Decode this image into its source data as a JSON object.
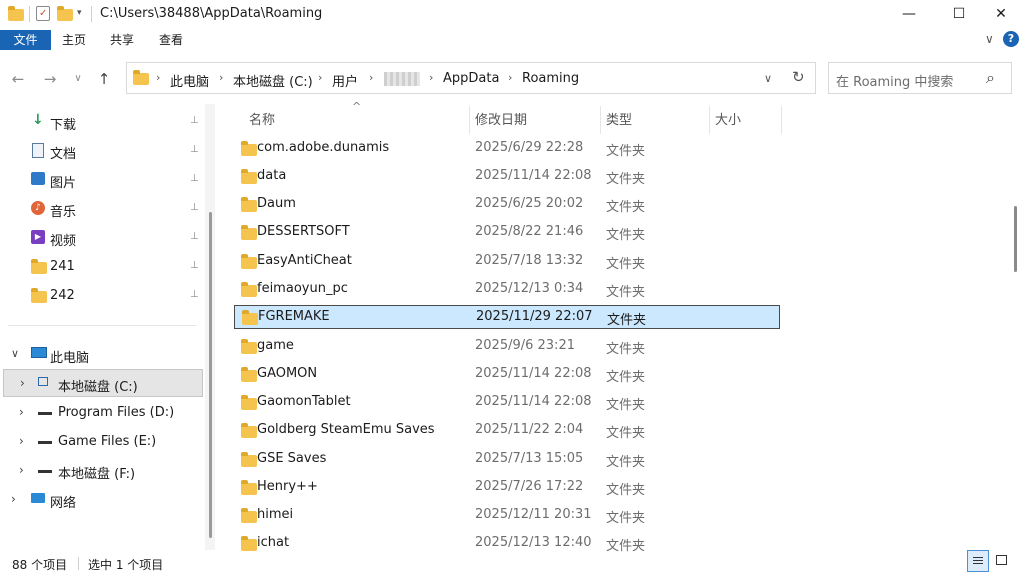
{
  "title": {
    "path": "C:\\Users\\38488\\AppData\\Roaming"
  },
  "window_controls": {
    "minimize": "—",
    "maximize": "☐",
    "close": "✕"
  },
  "ribbon": {
    "tabs": [
      "文件",
      "主页",
      "共享",
      "查看"
    ],
    "expand": "∨",
    "help": "?"
  },
  "nav_buttons": {
    "back": "←",
    "forward": "→",
    "recent": "∨",
    "up": "↑"
  },
  "address": {
    "crumbs": [
      "此电脑",
      "本地磁盘 (C:)",
      "用户",
      "AppData",
      "Roaming"
    ],
    "sep": "›",
    "dropdown": "∨",
    "refresh": "↻"
  },
  "search": {
    "placeholder": "在 Roaming 中搜索",
    "icon": "⌕"
  },
  "sidebar": {
    "quick": [
      {
        "label": "下载",
        "icon": "download-icon"
      },
      {
        "label": "文档",
        "icon": "document-icon"
      },
      {
        "label": "图片",
        "icon": "pictures-icon"
      },
      {
        "label": "音乐",
        "icon": "music-icon"
      },
      {
        "label": "视频",
        "icon": "video-icon"
      },
      {
        "label": "241",
        "icon": "folder-icon"
      },
      {
        "label": "242",
        "icon": "folder-icon"
      }
    ],
    "this_pc": "此电脑",
    "drives": [
      "本地磁盘 (C:)",
      "Program Files (D:)",
      "Game Files (E:)",
      "本地磁盘 (F:)"
    ],
    "network": "网络",
    "expand_open": "∨",
    "expand_closed": "›",
    "pin": "📌"
  },
  "columns": {
    "name": "名称",
    "date": "修改日期",
    "type": "类型",
    "size": "大小",
    "sort": "^"
  },
  "files": [
    {
      "name": "com.adobe.dunamis",
      "date": "2025/6/29 22:28",
      "type": "文件夹"
    },
    {
      "name": "data",
      "date": "2025/11/14 22:08",
      "type": "文件夹"
    },
    {
      "name": "Daum",
      "date": "2025/6/25 20:02",
      "type": "文件夹"
    },
    {
      "name": "DESSERTSOFT",
      "date": "2025/8/22 21:46",
      "type": "文件夹"
    },
    {
      "name": "EasyAntiCheat",
      "date": "2025/7/18 13:32",
      "type": "文件夹"
    },
    {
      "name": "feimaoyun_pc",
      "date": "2025/12/13 0:34",
      "type": "文件夹"
    },
    {
      "name": "FGREMAKE",
      "date": "2025/11/29 22:07",
      "type": "文件夹"
    },
    {
      "name": "game",
      "date": "2025/9/6 23:21",
      "type": "文件夹"
    },
    {
      "name": "GAOMON",
      "date": "2025/11/14 22:08",
      "type": "文件夹"
    },
    {
      "name": "GaomonTablet",
      "date": "2025/11/14 22:08",
      "type": "文件夹"
    },
    {
      "name": "Goldberg SteamEmu Saves",
      "date": "2025/11/22 2:04",
      "type": "文件夹"
    },
    {
      "name": "GSE Saves",
      "date": "2025/7/13 15:05",
      "type": "文件夹"
    },
    {
      "name": "Henry++",
      "date": "2025/7/26 17:22",
      "type": "文件夹"
    },
    {
      "name": "himei",
      "date": "2025/12/11 20:31",
      "type": "文件夹"
    },
    {
      "name": "ichat",
      "date": "2025/12/13 12:40",
      "type": "文件夹"
    }
  ],
  "selected_file": "FGREMAKE",
  "status": {
    "count": "88 个项目",
    "selected": "选中 1 个项目"
  }
}
